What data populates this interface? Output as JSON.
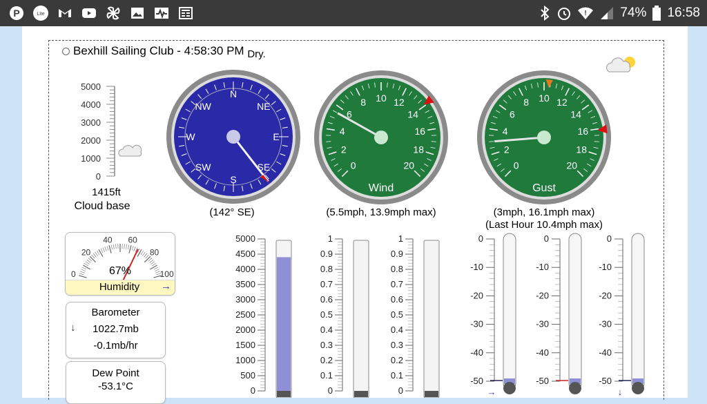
{
  "statusbar": {
    "app_icons": [
      "pinterest-icon",
      "meme-icon",
      "gmail-icon",
      "youtube-icon",
      "pinwheel-icon",
      "gallery-icon",
      "activity-icon",
      "news-icon"
    ],
    "right_icons": [
      "bluetooth-icon",
      "alarm-icon",
      "wifi-icon",
      "signal-icon"
    ],
    "battery": "74%",
    "time": "16:58"
  },
  "header": {
    "title": "Bexhill Sailing Club - 4:58:30 PM",
    "condition": "Dry."
  },
  "cloudbase": {
    "ticks": [
      "5000",
      "4000",
      "3000",
      "2000",
      "1000",
      "0"
    ],
    "value": 1415,
    "value_text": "1415ft",
    "label": "Cloud base"
  },
  "compass": {
    "points": [
      "N",
      "NE",
      "E",
      "SE",
      "S",
      "SW",
      "W",
      "NW"
    ],
    "bearing": 142,
    "caption": "(142° SE)"
  },
  "wind": {
    "title": "Wind",
    "ticks": [
      "0",
      "2",
      "4",
      "6",
      "8",
      "10",
      "12",
      "14",
      "16",
      "18",
      "20"
    ],
    "value": 5.5,
    "max": 13.9,
    "caption": "(5.5mph, 13.9mph max)"
  },
  "gust": {
    "title": "Gust",
    "ticks": [
      "0",
      "2",
      "4",
      "6",
      "8",
      "10",
      "12",
      "14",
      "16",
      "18",
      "20"
    ],
    "value": 3,
    "max": 16.1,
    "hour_max": 10.4,
    "caption": "(3mph, 16.1mph max)",
    "caption2": "(Last Hour 10.4mph max)"
  },
  "humidity": {
    "ticks": [
      "0",
      "20",
      "40",
      "60",
      "80",
      "100"
    ],
    "value": 67,
    "value_text": "67%",
    "label": "Humidity",
    "trend": "→"
  },
  "barometer": {
    "label": "Barometer",
    "value": "1022.7mb",
    "rate": "-0.1mb/hr",
    "trend": "↓"
  },
  "dewpoint": {
    "label": "Dew Point",
    "value": "-53.1°C"
  },
  "bars": [
    {
      "ticks": [
        "5000",
        "4500",
        "4000",
        "3500",
        "3000",
        "2500",
        "2000",
        "1500",
        "1000",
        "500",
        "0"
      ],
      "fill": 0.88,
      "accent": "#8f8fd6"
    },
    {
      "ticks": [
        "1",
        "0.9",
        "0.8",
        "0.7",
        "0.6",
        "0.5",
        "0.4",
        "0.3",
        "0.2",
        "0.1",
        "0"
      ],
      "fill": 0.0,
      "accent": "#8f8fd6"
    },
    {
      "ticks": [
        "1",
        "0.9",
        "0.8",
        "0.7",
        "0.6",
        "0.5",
        "0.4",
        "0.3",
        "0.2",
        "0.1",
        "0"
      ],
      "fill": 0.0,
      "accent": "#8f8fd6"
    }
  ],
  "thermos": [
    {
      "ticks": [
        "0",
        "-10",
        "-20",
        "-30",
        "-40",
        "-50"
      ],
      "trend": "→"
    },
    {
      "ticks": [
        "0",
        "-10",
        "-20",
        "-30",
        "-40",
        "-50"
      ],
      "trend": ""
    },
    {
      "ticks": [
        "0",
        "-10",
        "-20",
        "-30",
        "-40",
        "-50"
      ],
      "trend": "↓"
    }
  ],
  "colors": {
    "compass_face": "#2a2aa8",
    "gauge_face": "#1f7a3c",
    "needle_red": "#d11",
    "fill_blue": "#8f8fd6",
    "humidity_band": "#fff7c0"
  },
  "weather_icon": "cloud-sun-icon"
}
